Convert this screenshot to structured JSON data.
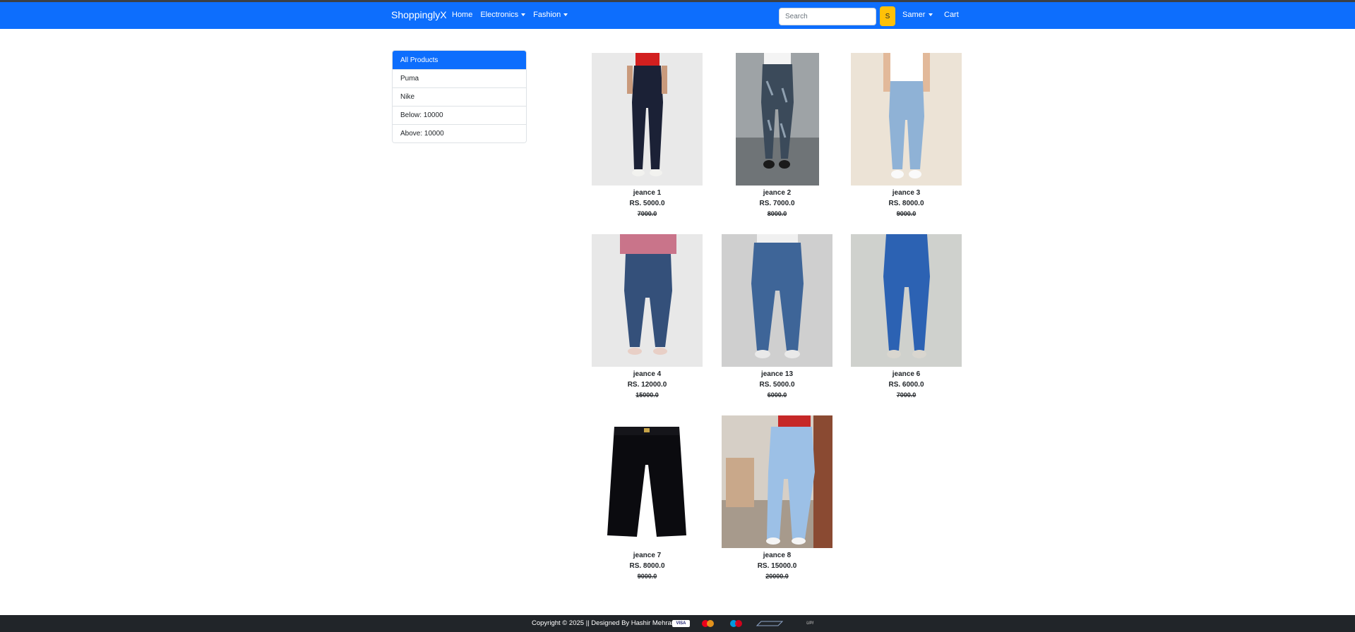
{
  "navbar": {
    "brand": "ShoppinglyX",
    "links": [
      {
        "label": "Home"
      },
      {
        "label": "Electronics"
      },
      {
        "label": "Fashion"
      }
    ],
    "search_placeholder": "Search",
    "search_button": "S",
    "user": "Samer",
    "cart": "Cart",
    "color": "#0d6efd"
  },
  "sidebar": {
    "items": [
      {
        "label": "All Products",
        "active": true
      },
      {
        "label": "Puma"
      },
      {
        "label": "Nike"
      },
      {
        "label": "Below: 10000"
      },
      {
        "label": "Above: 10000"
      }
    ]
  },
  "products": [
    {
      "name": "jeance 1",
      "price": "RS. 5000.0",
      "old_price": "7000.0"
    },
    {
      "name": "jeance 2",
      "price": "RS. 7000.0",
      "old_price": "8000.0"
    },
    {
      "name": "jeance 3",
      "price": "RS. 8000.0",
      "old_price": "9000.0"
    },
    {
      "name": "jeance 4",
      "price": "RS. 12000.0",
      "old_price": "15000.0"
    },
    {
      "name": "jeance 13",
      "price": "RS. 5000.0",
      "old_price": "6000.0"
    },
    {
      "name": "jeance 6",
      "price": "RS. 6000.0",
      "old_price": "7000.0"
    },
    {
      "name": "jeance 7",
      "price": "RS. 8000.0",
      "old_price": "9000.0"
    },
    {
      "name": "jeance 8",
      "price": "RS. 15000.0",
      "old_price": "20000.0"
    }
  ],
  "footer": {
    "text": "Copyright © 2025 || Designed By Hashir Mehran ||",
    "payment_icons": [
      "visa-icon",
      "mastercard-icon",
      "maestro-icon",
      "rupay-icon",
      "upi-icon"
    ],
    "payment_labels": {
      "visa": "VISA",
      "upi": "UPI"
    }
  }
}
